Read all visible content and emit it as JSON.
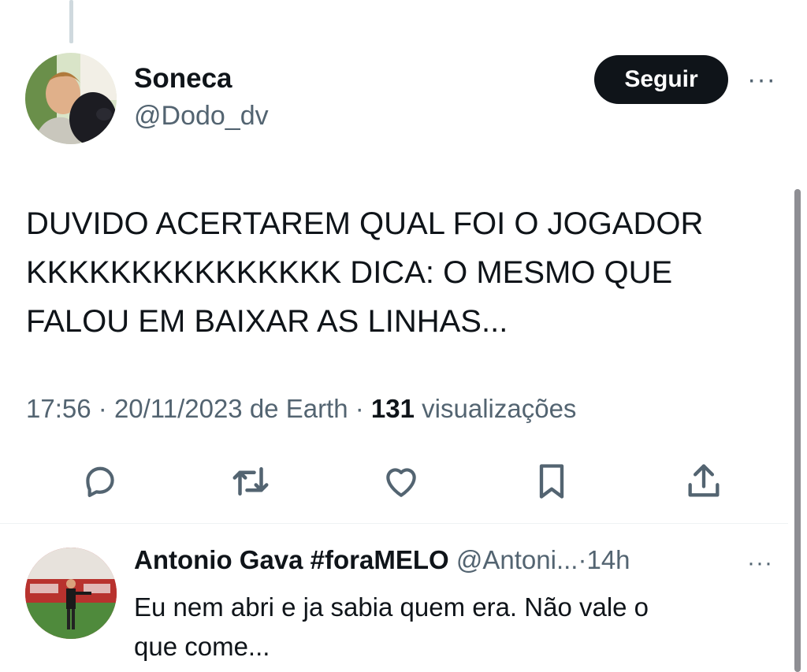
{
  "tweet": {
    "author_name": "Soneca",
    "author_handle": "@Dodo_dv",
    "follow_label": "Seguir",
    "more_label": "···",
    "text": "DUVIDO ACERTAREM QUAL FOI O JOGADOR\nKKKKKKKKKKKKKKK DICA: O MESMO QUE\nFALOU EM BAIXAR AS LINHAS...",
    "time": "17:56",
    "date": "20/11/2023",
    "source": "de Earth",
    "separator": "·",
    "views_count": "131",
    "views_label": "visualizações",
    "actions": [
      "reply-icon",
      "retweet-icon",
      "like-icon",
      "bookmark-icon",
      "share-icon"
    ]
  },
  "reply": {
    "author_name": "Antonio Gava #foraMELO",
    "author_handle": "@Antoni...",
    "separator": "·",
    "time": "14h",
    "more_label": "···",
    "text": "Eu nem abri e ja sabia quem era. Não vale o\nque come..."
  },
  "colors": {
    "text": "#0f1419",
    "secondary": "#536471",
    "button": "#0f1419",
    "divider": "#eff3f4"
  }
}
